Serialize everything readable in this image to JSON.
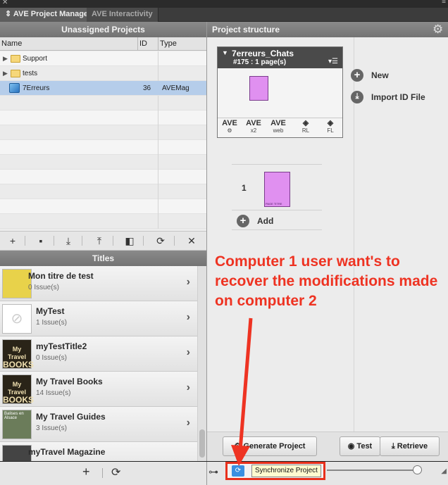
{
  "tabs": [
    {
      "label": "AVE Project Manager",
      "active": true
    },
    {
      "label": "AVE Interactivity",
      "active": false
    }
  ],
  "left_panel": {
    "header": "Unassigned Projects",
    "columns": [
      "Name",
      "ID",
      "Type"
    ],
    "rows": [
      {
        "name": "Support",
        "id": "",
        "type": "",
        "icon": "folder-icon",
        "expandable": true
      },
      {
        "name": "tests",
        "id": "",
        "type": "",
        "icon": "folder-icon",
        "expandable": true
      },
      {
        "name": "7Erreurs",
        "id": "36",
        "type": "AVEMag",
        "icon": "project-cube-icon",
        "selected": true
      }
    ],
    "toolbar": [
      "add-icon",
      "new-folder-icon",
      "import-icon",
      "export-icon",
      "duplicate-icon",
      "refresh-icon",
      "delete-icon"
    ],
    "toolbar_glyphs": [
      "+",
      "▪",
      "⤓",
      "⤒",
      "◧",
      "⟳",
      "✕"
    ]
  },
  "titles_panel": {
    "header": "Titles",
    "items": [
      {
        "name": "Mon titre de test",
        "count": "0",
        "suffix": "Issue(s)",
        "thumb_color": "#e8d24a"
      },
      {
        "name": "MyTest",
        "count": "1",
        "suffix": "Issue(s)",
        "thumb_color": "#ffffff"
      },
      {
        "name": "myTestTitle2",
        "count": "0",
        "suffix": "Issue(s)",
        "thumb_color": "#2a2418",
        "thumb_text": "My Travel BOOKS"
      },
      {
        "name": "My Travel Books",
        "count": "14",
        "suffix": "Issue(s)",
        "thumb_color": "#2a2418",
        "thumb_text": "My Travel BOOKS"
      },
      {
        "name": "My Travel Guides",
        "count": "3",
        "suffix": "Issue(s)",
        "thumb_color": "#6b7c5a",
        "thumb_text": "Balises en Alsace"
      },
      {
        "name": "myTravel Magazine",
        "count": "",
        "suffix": "",
        "thumb_color": "#444444"
      }
    ],
    "bottom_glyphs": [
      "+",
      "⟳"
    ]
  },
  "right_panel": {
    "header": "Project structure",
    "spread": {
      "name": "7erreurs_Chats",
      "pages": "#175 : 1 page(s)",
      "menu_glyph": "▾☰",
      "tools": [
        {
          "glyph": "AVE",
          "label": "",
          "icon": "ave-settings-icon"
        },
        {
          "glyph": "AVE",
          "label": "x2",
          "icon": "ave-x2-icon"
        },
        {
          "glyph": "AVE",
          "label": "web",
          "icon": "ave-web-icon"
        },
        {
          "glyph": "◈",
          "label": "RL",
          "icon": "reflow-rl-icon"
        },
        {
          "glyph": "◈",
          "label": "FL",
          "icon": "fixed-fl-icon"
        }
      ]
    },
    "page_number": "1",
    "page_caption": "PAGE  TITRE",
    "add_label": "Add",
    "side_actions": [
      {
        "label": "New",
        "glyph": "+"
      },
      {
        "label": "Import ID File",
        "glyph": "⤓"
      }
    ],
    "buttons": {
      "generate": "Generate Project",
      "test": "Test",
      "retrieve": "Retrieve"
    },
    "sync_label": "Synchronize Project",
    "slider_value": 0.95
  },
  "annotation": {
    "text": "Computer 1 user want's to recover the modifications made on computer 2"
  },
  "colors": {
    "annotation_red": "#ee3322",
    "selection": "#b5cdea",
    "page_fill": "#e090f0"
  }
}
